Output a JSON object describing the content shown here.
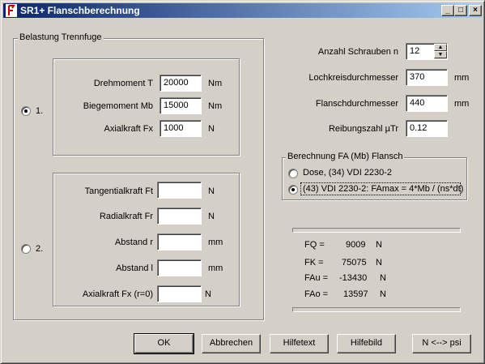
{
  "window": {
    "title": "SR1+  Flanschberechnung",
    "icon": "sr1-app-icon",
    "controls": [
      "minimize-icon",
      "maximize-icon",
      "close-icon"
    ]
  },
  "belastung": {
    "group_label": "Belastung Trennfuge",
    "option1": {
      "label": "1.",
      "selected": true,
      "fields": [
        {
          "label": "Drehmoment T",
          "value": "20000",
          "unit": "Nm"
        },
        {
          "label": "Biegemoment Mb",
          "value": "15000",
          "unit": "Nm"
        },
        {
          "label": "Axialkraft Fx",
          "value": "1000",
          "unit": "N"
        }
      ]
    },
    "option2": {
      "label": "2.",
      "selected": false,
      "fields": [
        {
          "label": "Tangentialkraft Ft",
          "value": "",
          "unit": "N"
        },
        {
          "label": "Radialkraft Fr",
          "value": "",
          "unit": "N"
        },
        {
          "label": "Abstand r",
          "value": "",
          "unit": "mm"
        },
        {
          "label": "Abstand l",
          "value": "",
          "unit": "mm"
        },
        {
          "label": "Axialkraft Fx (r=0)",
          "value": "",
          "unit": "N"
        }
      ]
    }
  },
  "params": {
    "schrauben": {
      "label": "Anzahl Schrauben n",
      "value": "12"
    },
    "lochkreis": {
      "label": "Lochkreisdurchmesser",
      "value": "370",
      "unit": "mm"
    },
    "flansch": {
      "label": "Flanschdurchmesser",
      "value": "440",
      "unit": "mm"
    },
    "reibung": {
      "label": "Reibungszahl µTr",
      "value": "0.12"
    }
  },
  "berechnung": {
    "group_label": "Berechnung FA (Mb) Flansch",
    "options": [
      {
        "label": "Dose, (34) VDI 2230-2",
        "selected": false
      },
      {
        "label": "(43) VDI 2230-2: FAmax = 4*Mb / (ns*dt)",
        "selected": true
      }
    ]
  },
  "results": [
    {
      "name": "FQ =",
      "value": "9009",
      "unit": "N"
    },
    {
      "name": "FK =",
      "value": "75075",
      "unit": "N"
    },
    {
      "name": "FAu =",
      "value": "-13430",
      "unit": "N"
    },
    {
      "name": "FAo =",
      "value": "13597",
      "unit": "N"
    }
  ],
  "buttons": {
    "ok": "OK",
    "abbrechen": "Abbrechen",
    "hilfetext": "Hilfetext",
    "hilfebild": "Hilfebild",
    "units": "N <--> psi"
  }
}
